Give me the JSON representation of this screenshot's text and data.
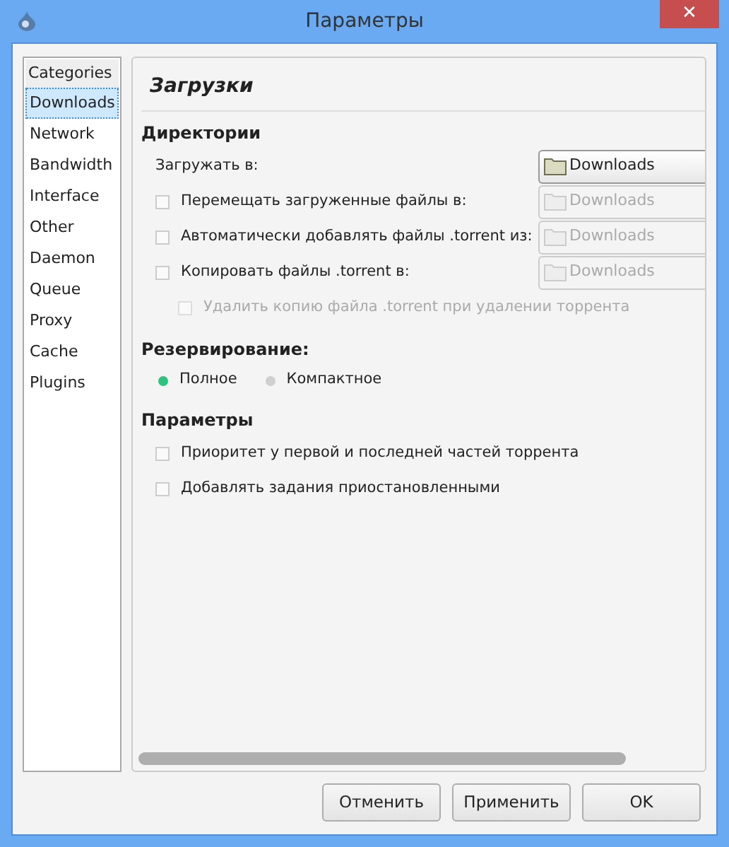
{
  "window": {
    "title": "Параметры",
    "close": "✕"
  },
  "sidebar": {
    "header": "Categories",
    "items": [
      {
        "label": "Downloads",
        "selected": true
      },
      {
        "label": "Network",
        "selected": false
      },
      {
        "label": "Bandwidth",
        "selected": false
      },
      {
        "label": "Interface",
        "selected": false
      },
      {
        "label": "Other",
        "selected": false
      },
      {
        "label": "Daemon",
        "selected": false
      },
      {
        "label": "Queue",
        "selected": false
      },
      {
        "label": "Proxy",
        "selected": false
      },
      {
        "label": "Cache",
        "selected": false
      },
      {
        "label": "Plugins",
        "selected": false
      }
    ]
  },
  "panel": {
    "title": "Загрузки",
    "sections": [
      {
        "heading": "Директории",
        "kind": "rows",
        "rows": [
          {
            "kind": "label",
            "label": "Загружать в:",
            "path": {
              "value": "Downloads",
              "disabled": false
            }
          },
          {
            "kind": "checkbox",
            "label": "Перемещать загруженные файлы в:",
            "checked": false,
            "disabled": false,
            "path": {
              "value": "Downloads",
              "disabled": true
            }
          },
          {
            "kind": "checkbox",
            "label": "Автоматически добавлять файлы .torrent из:",
            "checked": false,
            "disabled": false,
            "path": {
              "value": "Downloads",
              "disabled": true
            }
          },
          {
            "kind": "checkbox",
            "label": "Копировать файлы .torrent в:",
            "checked": false,
            "disabled": false,
            "path": {
              "value": "Downloads",
              "disabled": true
            },
            "children": [
              {
                "kind": "checkbox",
                "label": "Удалить копию файла .torrent при удалении торрента",
                "checked": false,
                "disabled": true
              }
            ]
          }
        ]
      },
      {
        "heading": "Резервирование:",
        "kind": "radios",
        "options": [
          {
            "label": "Полное",
            "selected": true
          },
          {
            "label": "Компактное",
            "selected": false
          }
        ]
      },
      {
        "heading": "Параметры",
        "kind": "rows",
        "rows": [
          {
            "kind": "checkbox",
            "label": "Приоритет у первой и последней частей торрента",
            "checked": false,
            "disabled": false
          },
          {
            "kind": "checkbox",
            "label": "Добавлять задания приостановленными",
            "checked": false,
            "disabled": false
          }
        ]
      }
    ]
  },
  "buttons": [
    "Отменить",
    "Применить",
    "OK"
  ]
}
